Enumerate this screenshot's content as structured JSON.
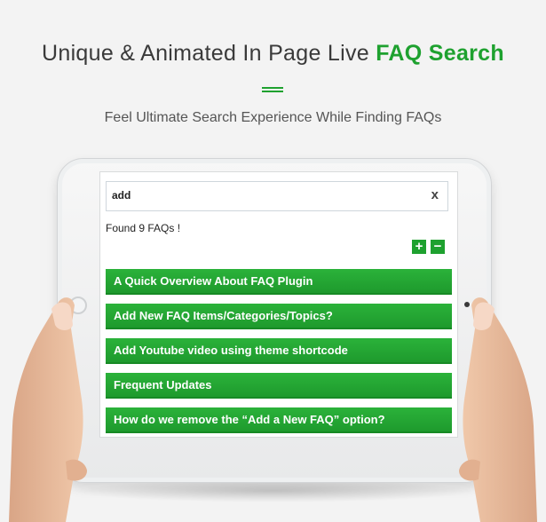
{
  "header": {
    "title_prefix": "Unique & Animated In Page Live ",
    "title_accent": "FAQ Search",
    "subtitle": "Feel Ultimate Search Experience While Finding FAQs"
  },
  "search": {
    "value": "add",
    "clear_label": "x"
  },
  "result": {
    "found_text": "Found 9 FAQs !"
  },
  "controls": {
    "expand_label": "+",
    "collapse_label": "−"
  },
  "faqs": [
    {
      "title": "A Quick Overview About FAQ Plugin"
    },
    {
      "title": "Add New FAQ Items/Categories/Topics?"
    },
    {
      "title": "Add Youtube video using theme shortcode"
    },
    {
      "title": "Frequent Updates"
    },
    {
      "title": "How do we remove the “Add a New FAQ” option?"
    }
  ],
  "colors": {
    "accent": "#1ea12f",
    "background": "#f3f3f3"
  }
}
